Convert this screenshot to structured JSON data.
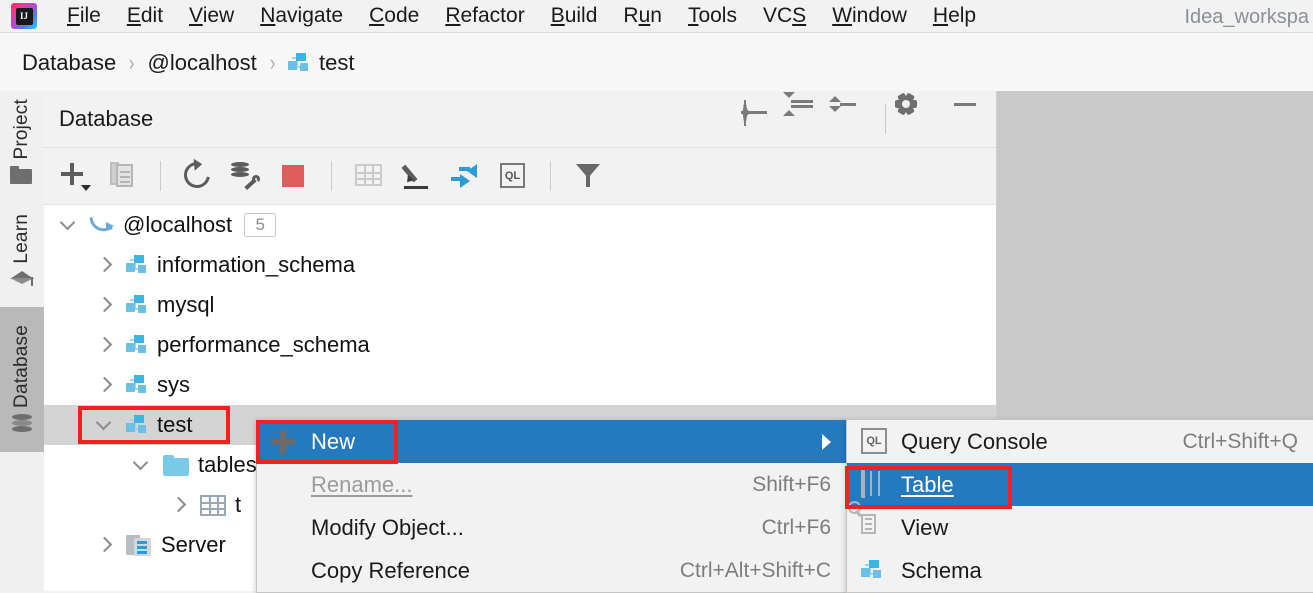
{
  "menubar": {
    "items": [
      "File",
      "Edit",
      "View",
      "Navigate",
      "Code",
      "Refactor",
      "Build",
      "Run",
      "Tools",
      "VCS",
      "Window",
      "Help"
    ],
    "window_title": "Idea_workspa"
  },
  "breadcrumb": {
    "items": [
      "Database",
      "@localhost",
      "test"
    ],
    "separator": "›"
  },
  "stripe": {
    "items": [
      {
        "label": "Project",
        "icon": "folder-icon",
        "active": false
      },
      {
        "label": "Learn",
        "icon": "graduation-cap-icon",
        "active": false
      },
      {
        "label": "Database",
        "icon": "database-stack-icon",
        "active": true
      }
    ]
  },
  "toolwindow": {
    "title": "Database",
    "header_actions": [
      {
        "name": "scroll-from-source-icon",
        "tooltip": "Scroll from Source"
      },
      {
        "name": "expand-all-icon",
        "tooltip": "Expand All"
      },
      {
        "name": "collapse-all-icon",
        "tooltip": "Collapse All"
      },
      {
        "name": "settings-gear-icon",
        "tooltip": "Options"
      },
      {
        "name": "minimize-icon",
        "tooltip": "Hide"
      }
    ],
    "toolbar_actions": [
      {
        "name": "add-new-icon",
        "tooltip": "New"
      },
      {
        "name": "duplicate-icon",
        "tooltip": "Duplicate"
      },
      {
        "name": "refresh-icon",
        "tooltip": "Refresh"
      },
      {
        "name": "db-settings-icon",
        "tooltip": "Data Source Properties"
      },
      {
        "name": "stop-icon",
        "tooltip": "Stop"
      },
      {
        "name": "data-grid-icon",
        "tooltip": "Open Data"
      },
      {
        "name": "edit-pencil-icon",
        "tooltip": "Modify"
      },
      {
        "name": "jump-to-editor-icon",
        "tooltip": "Jump to Editor"
      },
      {
        "name": "query-console-icon",
        "tooltip": "New Query Console"
      },
      {
        "name": "filter-icon",
        "tooltip": "Filter"
      }
    ]
  },
  "tree": {
    "nodes": [
      {
        "label": "@localhost",
        "icon": "mysql-dolphin-icon",
        "badge": "5",
        "expanded": true,
        "indent": 0,
        "selected": false
      },
      {
        "label": "information_schema",
        "icon": "schema-icon",
        "badge": "",
        "expanded": false,
        "indent": 1,
        "selected": false
      },
      {
        "label": "mysql",
        "icon": "schema-icon",
        "badge": "",
        "expanded": false,
        "indent": 1,
        "selected": false
      },
      {
        "label": "performance_schema",
        "icon": "schema-icon",
        "badge": "",
        "expanded": false,
        "indent": 1,
        "selected": false
      },
      {
        "label": "sys",
        "icon": "schema-icon",
        "badge": "",
        "expanded": false,
        "indent": 1,
        "selected": false
      },
      {
        "label": "test",
        "icon": "schema-icon",
        "badge": "",
        "expanded": true,
        "indent": 1,
        "selected": true
      },
      {
        "label": "tables",
        "icon": "folder-blue-icon",
        "badge": "",
        "expanded": true,
        "indent": 2,
        "selected": false
      },
      {
        "label": "t",
        "icon": "table-icon",
        "badge": "",
        "expanded": false,
        "indent": 3,
        "selected": false
      },
      {
        "label": "Server",
        "icon": "server-objects-icon",
        "badge": "",
        "expanded": false,
        "indent": 1,
        "selected": false
      }
    ]
  },
  "context_menu": {
    "items": [
      {
        "label": "New",
        "shortcut": "",
        "icon": "plus-icon",
        "highlighted": true,
        "disabled": false,
        "submenu": true,
        "underline_index": -1
      },
      {
        "label": "Rename...",
        "shortcut": "Shift+F6",
        "icon": "",
        "highlighted": false,
        "disabled": true,
        "submenu": false,
        "underline_index": 0
      },
      {
        "label": "Modify Object...",
        "shortcut": "Ctrl+F6",
        "icon": "",
        "highlighted": false,
        "disabled": false,
        "submenu": false,
        "underline_index": -1
      },
      {
        "label": "Copy Reference",
        "shortcut": "Ctrl+Alt+Shift+C",
        "icon": "",
        "highlighted": false,
        "disabled": false,
        "submenu": false,
        "underline_index": 3
      }
    ]
  },
  "submenu": {
    "items": [
      {
        "label": "Query Console",
        "shortcut": "Ctrl+Shift+Q",
        "icon": "query-console-icon",
        "highlighted": false
      },
      {
        "label": "Table",
        "shortcut": "",
        "icon": "table-icon",
        "highlighted": true
      },
      {
        "label": "View",
        "shortcut": "",
        "icon": "view-icon",
        "highlighted": false
      },
      {
        "label": "Schema",
        "shortcut": "",
        "icon": "schema-icon",
        "highlighted": false
      }
    ]
  },
  "annotations": {
    "highlight_color": "#f41f1f",
    "boxes": [
      "test-tree-node",
      "new-menu-item",
      "table-submenu-item"
    ]
  },
  "colors": {
    "menu_highlight": "#2579bf",
    "selection_gray": "#d4d4d4",
    "panel_bg": "#f2f2f2",
    "editor_bg": "#c9c9c9",
    "accent_blue": "#2e9bd6"
  }
}
